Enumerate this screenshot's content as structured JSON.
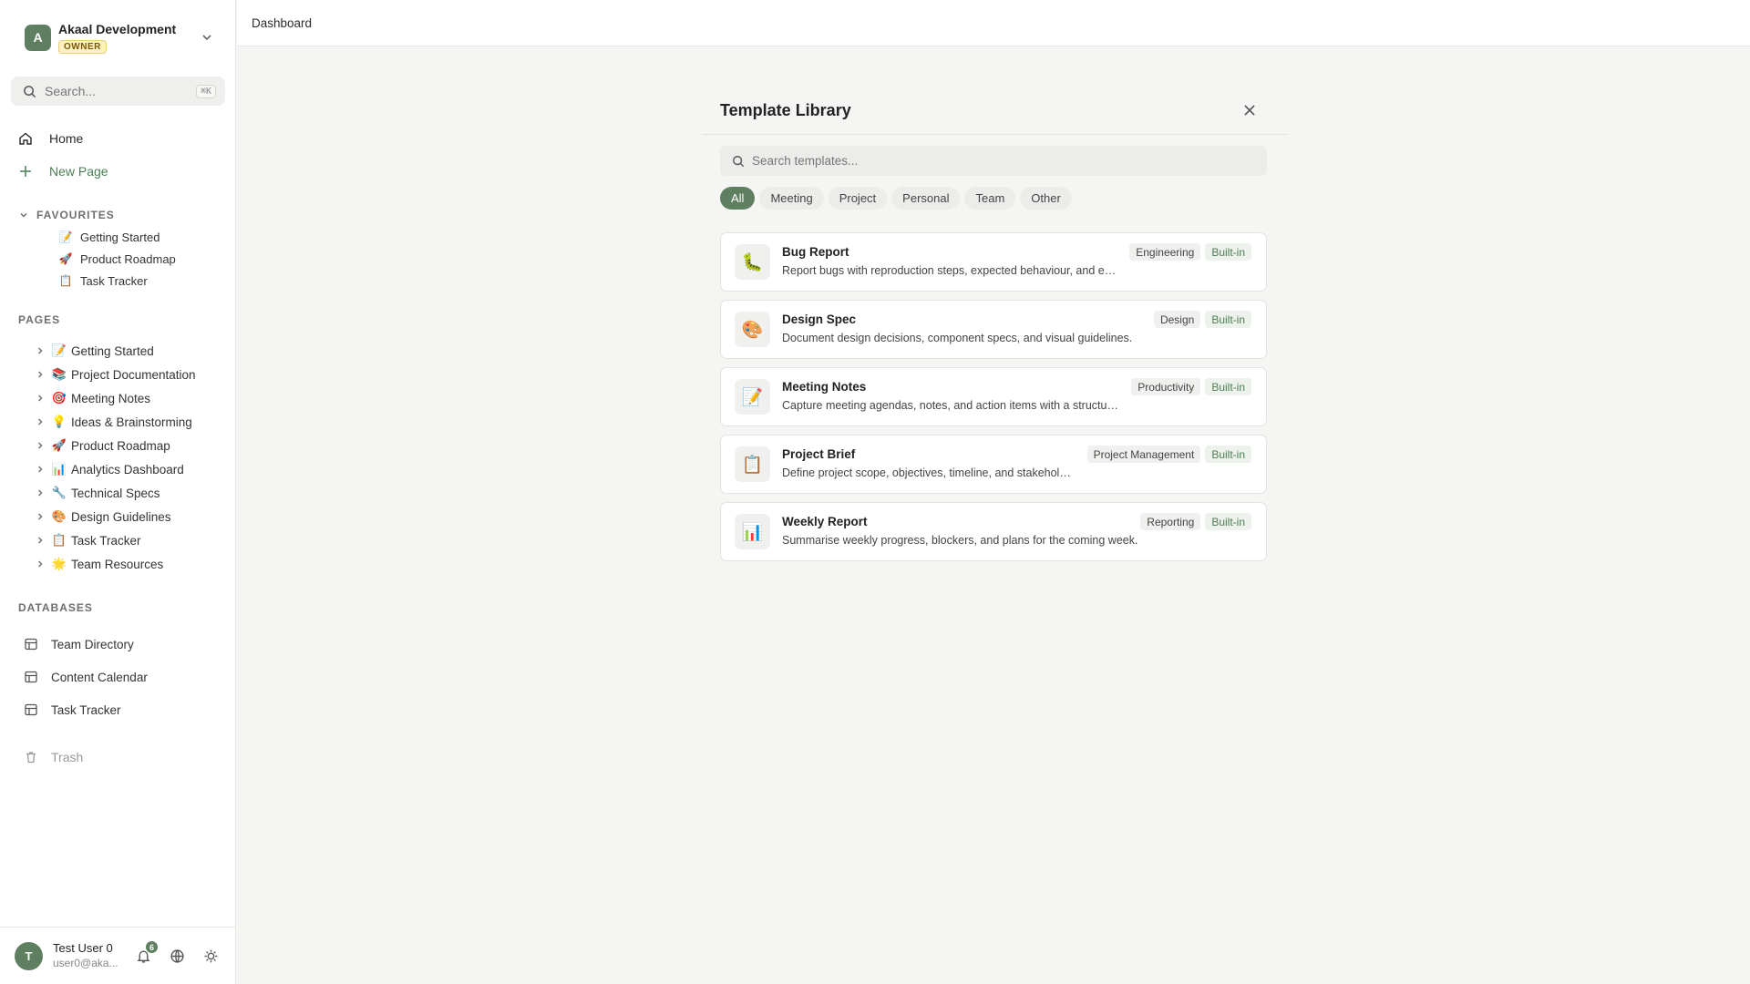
{
  "workspace": {
    "avatar_letter": "A",
    "name": "Akaal Development",
    "role": "OWNER"
  },
  "search": {
    "placeholder": "Search...",
    "shortcut": "⌘K"
  },
  "nav": {
    "home": "Home",
    "new_page": "New Page",
    "trash": "Trash"
  },
  "favourites": {
    "heading": "FAVOURITES",
    "items": [
      {
        "emoji": "📝",
        "label": "Getting Started"
      },
      {
        "emoji": "🚀",
        "label": "Product Roadmap"
      },
      {
        "emoji": "📋",
        "label": "Task Tracker"
      }
    ]
  },
  "pages": {
    "heading": "PAGES",
    "items": [
      {
        "emoji": "📝",
        "label": "Getting Started"
      },
      {
        "emoji": "📚",
        "label": "Project Documentation"
      },
      {
        "emoji": "🎯",
        "label": "Meeting Notes"
      },
      {
        "emoji": "💡",
        "label": "Ideas & Brainstorming"
      },
      {
        "emoji": "🚀",
        "label": "Product Roadmap"
      },
      {
        "emoji": "📊",
        "label": "Analytics Dashboard"
      },
      {
        "emoji": "🔧",
        "label": "Technical Specs"
      },
      {
        "emoji": "🎨",
        "label": "Design Guidelines"
      },
      {
        "emoji": "📋",
        "label": "Task Tracker"
      },
      {
        "emoji": "🌟",
        "label": "Team Resources"
      }
    ]
  },
  "databases": {
    "heading": "DATABASES",
    "items": [
      {
        "label": "Team Directory"
      },
      {
        "label": "Content Calendar"
      },
      {
        "label": "Task Tracker"
      }
    ]
  },
  "user": {
    "avatar_letter": "T",
    "name": "Test User 0",
    "email": "user0@aka...",
    "notifications": "6"
  },
  "topbar": {
    "breadcrumb": "Dashboard"
  },
  "modal": {
    "title": "Template Library",
    "search_placeholder": "Search templates...",
    "filters": [
      "All",
      "Meeting",
      "Project",
      "Personal",
      "Team",
      "Other"
    ],
    "active_filter": "All",
    "templates": [
      {
        "icon": "🐛",
        "title": "Bug Report",
        "description": "Report bugs with reproduction steps, expected behaviour, and env…",
        "category": "Engineering",
        "badge": "Built-in"
      },
      {
        "icon": "🎨",
        "title": "Design Spec",
        "description": "Document design decisions, component specs, and visual guidelines.",
        "category": "Design",
        "badge": "Built-in"
      },
      {
        "icon": "📝",
        "title": "Meeting Notes",
        "description": "Capture meeting agendas, notes, and action items with a structure…",
        "category": "Productivity",
        "badge": "Built-in"
      },
      {
        "icon": "📋",
        "title": "Project Brief",
        "description": "Define project scope, objectives, timeline, and stakeholde…",
        "category": "Project Management",
        "badge": "Built-in"
      },
      {
        "icon": "📊",
        "title": "Weekly Report",
        "description": "Summarise weekly progress, blockers, and plans for the coming week.",
        "category": "Reporting",
        "badge": "Built-in"
      }
    ]
  }
}
